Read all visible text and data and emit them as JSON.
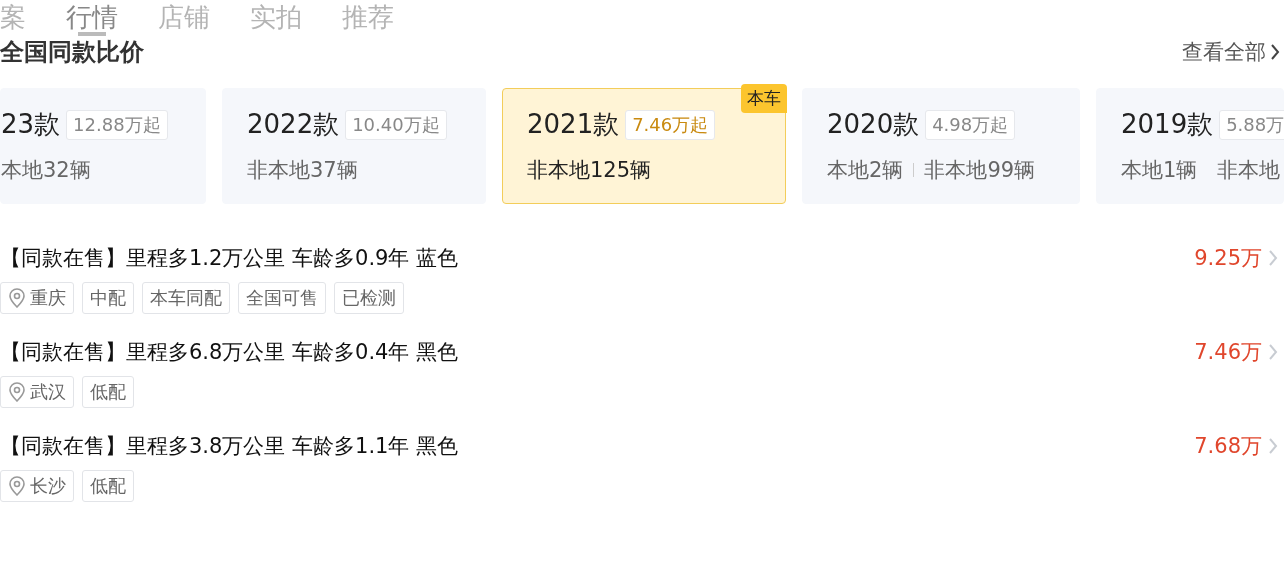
{
  "tabs": [
    {
      "label": "案",
      "selected": false
    },
    {
      "label": "行情",
      "selected": true
    },
    {
      "label": "店铺",
      "selected": false
    },
    {
      "label": "实拍",
      "selected": false
    },
    {
      "label": "推荐",
      "selected": false
    }
  ],
  "section": {
    "title": "全国同款比价",
    "link": "查看全部"
  },
  "models": [
    {
      "year": "23款",
      "price": "12.88万起",
      "stats": [
        "本地32辆"
      ],
      "current": false
    },
    {
      "year": "2022款",
      "price": "10.40万起",
      "stats": [
        "非本地37辆"
      ],
      "current": false
    },
    {
      "year": "2021款",
      "price": "7.46万起",
      "stats": [
        "非本地125辆"
      ],
      "current": true,
      "badge": "本车"
    },
    {
      "year": "2020款",
      "price": "4.98万起",
      "stats": [
        "本地2辆",
        "非本地99辆"
      ],
      "current": false
    },
    {
      "year": "2019款",
      "price": "5.88万",
      "stats": [
        "本地1辆",
        "非本地"
      ],
      "current": false
    }
  ],
  "listings": [
    {
      "title": "【同款在售】里程多1.2万公里 车龄多0.9年 蓝色",
      "price": "9.25万",
      "tags": [
        {
          "kind": "location",
          "label": "重庆"
        },
        {
          "kind": "plain",
          "label": "中配"
        },
        {
          "kind": "plain",
          "label": "本车同配"
        },
        {
          "kind": "plain",
          "label": "全国可售"
        },
        {
          "kind": "plain",
          "label": "已检测"
        }
      ]
    },
    {
      "title": "【同款在售】里程多6.8万公里 车龄多0.4年 黑色",
      "price": "7.46万",
      "tags": [
        {
          "kind": "location",
          "label": "武汉"
        },
        {
          "kind": "plain",
          "label": "低配"
        }
      ]
    },
    {
      "title": "【同款在售】里程多3.8万公里 车龄多1.1年 黑色",
      "price": "7.68万",
      "tags": [
        {
          "kind": "location",
          "label": "长沙"
        },
        {
          "kind": "plain",
          "label": "低配"
        }
      ]
    }
  ]
}
